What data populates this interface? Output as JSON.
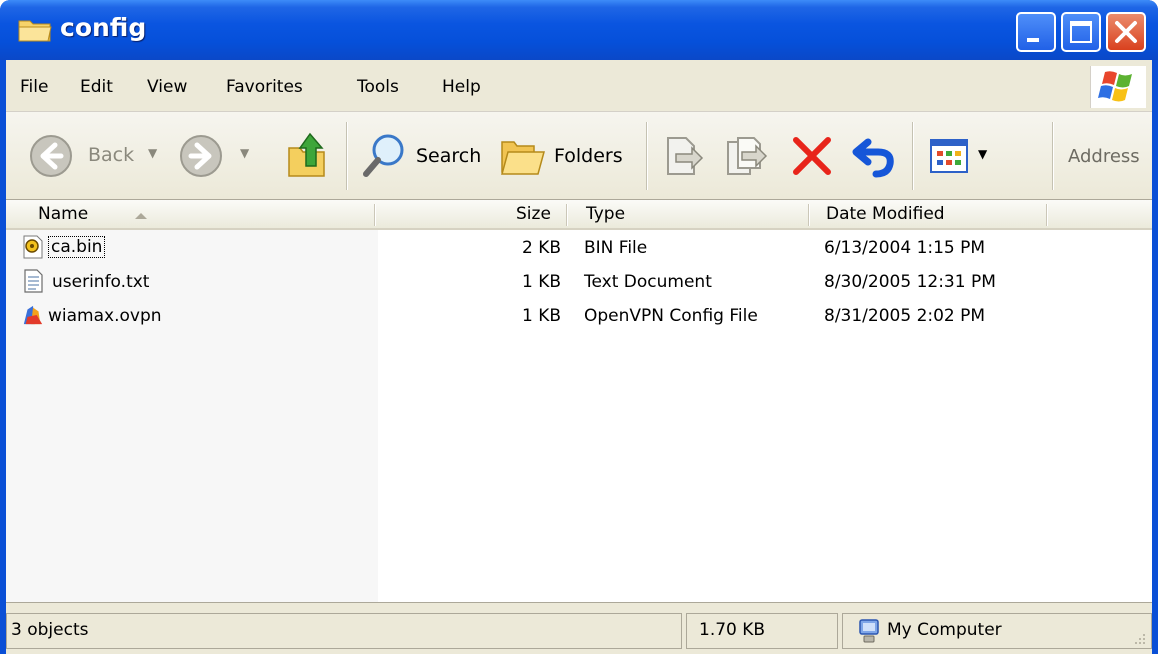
{
  "window": {
    "title": "config"
  },
  "menu": {
    "items": [
      "File",
      "Edit",
      "View",
      "Favorites",
      "Tools",
      "Help"
    ]
  },
  "toolbar": {
    "back_label": "Back",
    "search_label": "Search",
    "folders_label": "Folders",
    "address_label": "Address"
  },
  "columns": {
    "name": "Name",
    "size": "Size",
    "type": "Type",
    "date": "Date Modified"
  },
  "files": [
    {
      "name": "ca.bin",
      "size": "2 KB",
      "type": "BIN File",
      "date": "6/13/2004 1:15 PM",
      "icon": "bin-file-icon"
    },
    {
      "name": "userinfo.txt",
      "size": "1 KB",
      "type": "Text Document",
      "date": "8/30/2005 12:31 PM",
      "icon": "text-file-icon"
    },
    {
      "name": "wiamax.ovpn",
      "size": "1 KB",
      "type": "OpenVPN Config File",
      "date": "8/31/2005 2:02 PM",
      "icon": "openvpn-file-icon"
    }
  ],
  "status": {
    "objects": "3 objects",
    "size": "1.70 KB",
    "location": "My Computer"
  },
  "colors": {
    "titlebar": "#0a55e0",
    "frame": "#ece9d8",
    "close": "#d9411e"
  }
}
